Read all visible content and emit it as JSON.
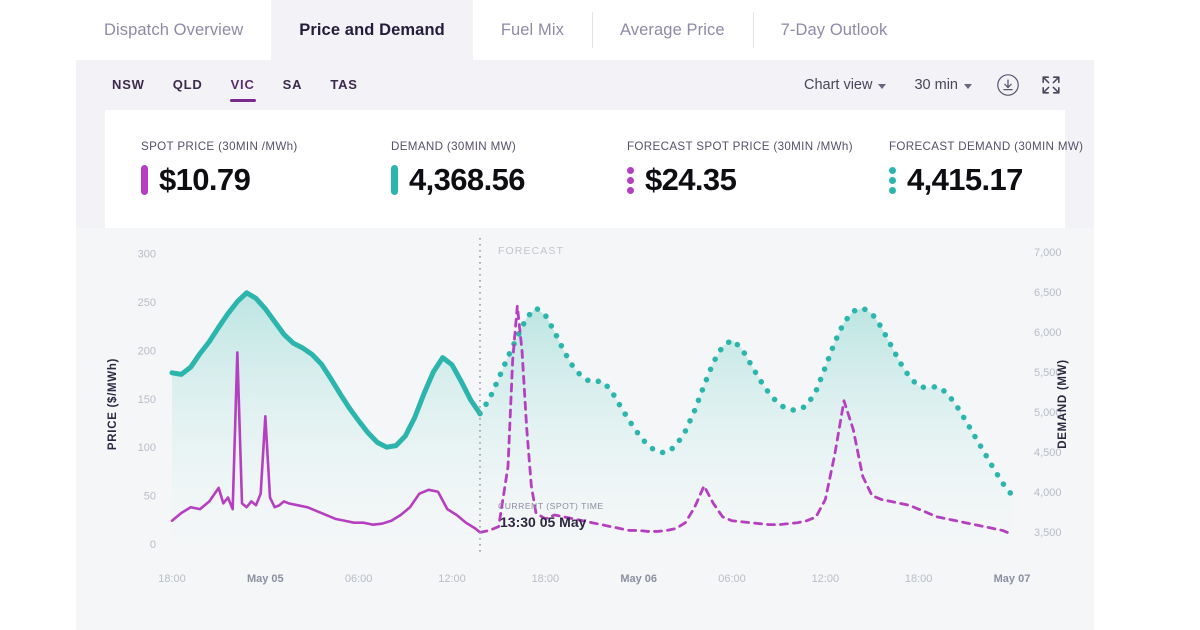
{
  "tabs": [
    {
      "label": "Dispatch Overview",
      "active": false
    },
    {
      "label": "Price and Demand",
      "active": true
    },
    {
      "label": "Fuel Mix",
      "active": false
    },
    {
      "label": "Average Price",
      "active": false
    },
    {
      "label": "7-Day Outlook",
      "active": false
    }
  ],
  "toolbar": {
    "regions": [
      {
        "label": "NSW",
        "active": false
      },
      {
        "label": "QLD",
        "active": false
      },
      {
        "label": "VIC",
        "active": true
      },
      {
        "label": "SA",
        "active": false
      },
      {
        "label": "TAS",
        "active": false
      }
    ],
    "chart_view_label": "Chart view",
    "interval_label": "30 min",
    "download_icon": "download-icon",
    "fullscreen_icon": "fullscreen-icon"
  },
  "metrics": [
    {
      "label": "SPOT PRICE (30MIN /MWh)",
      "value": "$10.79",
      "marker": "bar",
      "color": "#b53fc0"
    },
    {
      "label": "DEMAND (30MIN MW)",
      "value": "4,368.56",
      "marker": "bar",
      "color": "#2bb5ad"
    },
    {
      "label": "FORECAST SPOT PRICE (30MIN /MWh)",
      "value": "$24.35",
      "marker": "dots",
      "color": "#b53fc0"
    },
    {
      "label": "FORECAST DEMAND (30MIN MW)",
      "value": "4,415.17",
      "marker": "dots",
      "color": "#2bb5ad"
    }
  ],
  "annotations": {
    "forecast_label": "FORECAST",
    "current_time_label": "CURRENT (SPOT) TIME",
    "current_time_value": "13:30 05 May"
  },
  "chart_data": {
    "type": "line",
    "title": "",
    "xlabel": "",
    "ylabel": "PRICE ($/MWh)",
    "y2label": "DEMAND (MW)",
    "grid": false,
    "legend_position": "none",
    "colors": {
      "price": "#b53fc0",
      "demand": "#2bb5ad",
      "demand_fill_top": "#b9e4e1",
      "demand_fill_bottom": "#f4f9f8"
    },
    "ylim": [
      0,
      310
    ],
    "yticks": [
      0,
      50,
      100,
      150,
      200,
      250,
      300
    ],
    "yticklabels": [
      "0",
      "50",
      "100",
      "150",
      "200",
      "250",
      "300"
    ],
    "y2lim": [
      3350,
      7100
    ],
    "y2ticks": [
      3500,
      4000,
      4500,
      5000,
      5500,
      6000,
      6500,
      7000
    ],
    "y2ticklabels": [
      "3,500",
      "4,000",
      "4,500",
      "5,000",
      "5,500",
      "6,000",
      "6,500",
      "7,000"
    ],
    "xticks": [
      0,
      4,
      8,
      12,
      16,
      20,
      24,
      28,
      32,
      36
    ],
    "xticklabels": [
      "18:00",
      "May 05",
      "06:00",
      "12:00",
      "18:00",
      "May 06",
      "06:00",
      "12:00",
      "18:00",
      "May 07"
    ],
    "xticklabels_bold": [
      false,
      true,
      false,
      false,
      false,
      true,
      false,
      false,
      false,
      true
    ],
    "forecast_boundary_x": 13.2,
    "series": [
      {
        "name": "Demand (MW)",
        "axis": "y2",
        "style": "solid",
        "x": [
          0.0,
          0.4,
          0.8,
          1.2,
          1.6,
          2.0,
          2.4,
          2.8,
          3.2,
          3.6,
          4.0,
          4.4,
          4.8,
          5.2,
          5.6,
          6.0,
          6.4,
          6.8,
          7.2,
          7.6,
          8.0,
          8.4,
          8.8,
          9.2,
          9.6,
          10.0,
          10.4,
          10.8,
          11.2,
          11.6,
          12.0,
          12.4,
          12.8,
          13.2
        ],
        "values": [
          5490,
          5470,
          5560,
          5730,
          5880,
          6060,
          6230,
          6380,
          6490,
          6420,
          6290,
          6130,
          5970,
          5860,
          5800,
          5720,
          5600,
          5420,
          5230,
          5050,
          4890,
          4740,
          4620,
          4560,
          4580,
          4700,
          4930,
          5230,
          5500,
          5680,
          5590,
          5380,
          5150,
          4980
        ]
      },
      {
        "name": "Price ($/MWh)",
        "axis": "y",
        "style": "solid",
        "x": [
          0.0,
          0.4,
          0.8,
          1.2,
          1.6,
          2.0,
          2.2,
          2.4,
          2.6,
          2.8,
          3.0,
          3.2,
          3.4,
          3.6,
          3.8,
          4.0,
          4.2,
          4.4,
          4.6,
          4.8,
          5.0,
          5.4,
          5.8,
          6.2,
          6.6,
          7.0,
          7.4,
          7.8,
          8.2,
          8.6,
          9.0,
          9.4,
          9.8,
          10.2,
          10.6,
          11.0,
          11.4,
          11.8,
          12.2,
          12.6,
          13.0,
          13.2
        ],
        "values": [
          24,
          32,
          38,
          36,
          44,
          58,
          42,
          48,
          36,
          198,
          42,
          38,
          44,
          40,
          52,
          132,
          48,
          38,
          40,
          44,
          42,
          40,
          38,
          34,
          30,
          26,
          24,
          22,
          22,
          20,
          21,
          24,
          30,
          38,
          52,
          56,
          54,
          36,
          30,
          22,
          16,
          12
        ]
      },
      {
        "name": "Forecast Demand (MW)",
        "axis": "y2",
        "style": "dotted",
        "x": [
          13.2,
          13.6,
          14.0,
          14.4,
          14.8,
          15.2,
          15.6,
          16.0,
          16.4,
          16.8,
          17.2,
          17.6,
          18.0,
          18.4,
          18.8,
          19.2,
          19.6,
          20.0,
          20.4,
          20.8,
          21.2,
          21.6,
          22.0,
          22.4,
          22.8,
          23.2,
          23.6,
          24.0,
          24.4,
          24.8,
          25.2,
          25.6,
          26.0,
          26.4,
          26.8,
          27.2,
          27.6,
          28.0,
          28.4,
          28.8,
          29.2,
          29.6,
          30.0,
          30.4,
          30.8,
          31.2,
          31.6,
          32.0,
          32.4,
          32.8,
          33.2,
          33.6,
          34.0,
          34.4,
          34.8,
          35.2,
          35.6,
          36.0
        ],
        "values": [
          4980,
          5160,
          5420,
          5690,
          5940,
          6180,
          6300,
          6210,
          6000,
          5760,
          5560,
          5430,
          5370,
          5390,
          5280,
          5080,
          4890,
          4720,
          4580,
          4500,
          4490,
          4580,
          4760,
          5020,
          5330,
          5620,
          5820,
          5900,
          5800,
          5600,
          5400,
          5230,
          5100,
          5030,
          5020,
          5080,
          5260,
          5560,
          5870,
          6120,
          6260,
          6300,
          6230,
          6060,
          5840,
          5620,
          5440,
          5320,
          5300,
          5320,
          5240,
          5090,
          4900,
          4700,
          4500,
          4300,
          4110,
          3960
        ]
      },
      {
        "name": "Forecast Price ($/MWh)",
        "axis": "y",
        "style": "dashed",
        "x": [
          13.2,
          13.6,
          14.0,
          14.4,
          14.6,
          14.8,
          15.0,
          15.2,
          15.4,
          15.6,
          16.0,
          16.4,
          16.8,
          17.2,
          17.6,
          18.0,
          18.4,
          18.8,
          19.2,
          19.6,
          20.0,
          20.4,
          20.8,
          21.2,
          21.6,
          22.0,
          22.4,
          22.8,
          23.2,
          23.6,
          24.0,
          24.4,
          24.8,
          25.2,
          25.6,
          26.0,
          26.4,
          26.8,
          27.2,
          27.6,
          28.0,
          28.4,
          28.8,
          29.2,
          29.6,
          30.0,
          30.4,
          30.8,
          31.2,
          31.6,
          32.0,
          32.4,
          32.8,
          33.2,
          33.6,
          34.0,
          34.4,
          34.8,
          35.2,
          35.6,
          36.0
        ],
        "values": [
          12,
          14,
          18,
          80,
          190,
          246,
          200,
          120,
          60,
          32,
          26,
          30,
          28,
          26,
          24,
          22,
          20,
          18,
          16,
          14,
          14,
          13,
          13,
          14,
          16,
          22,
          38,
          60,
          42,
          28,
          24,
          23,
          22,
          21,
          20,
          20,
          21,
          22,
          24,
          28,
          46,
          92,
          148,
          118,
          70,
          50,
          46,
          44,
          42,
          40,
          36,
          32,
          28,
          26,
          24,
          22,
          20,
          18,
          16,
          14,
          10
        ]
      }
    ]
  }
}
